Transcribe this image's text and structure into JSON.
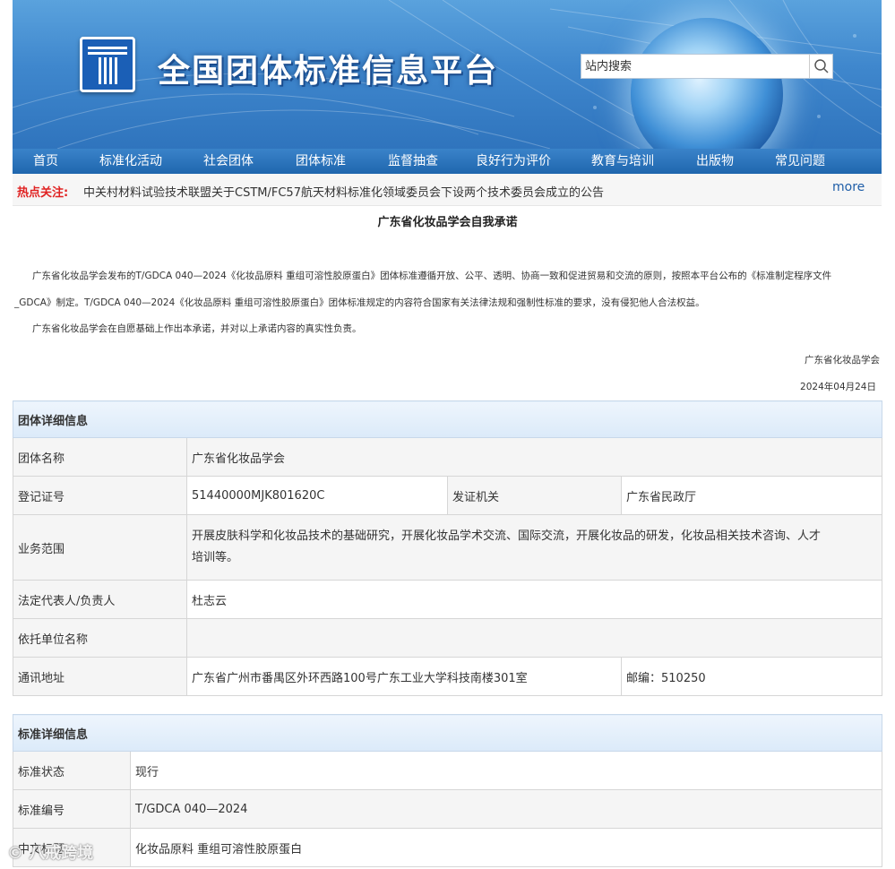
{
  "header": {
    "site_title": "全国团体标准信息平台",
    "search_placeholder": "站内搜索"
  },
  "nav": {
    "items": [
      "首页",
      "标准化活动",
      "社会团体",
      "团体标准",
      "监督抽查",
      "良好行为评价",
      "教育与培训",
      "出版物",
      "常见问题"
    ]
  },
  "hotbar": {
    "label": "热点关注:",
    "text": "中关村材料试验技术联盟关于CSTM/FC57航天材料标准化领域委员会下设两个技术委员会成立的公告",
    "more": "more"
  },
  "commitment": {
    "title": "广东省化妆品学会自我承诺",
    "para1_line1": "广东省化妆品学会发布的T/GDCA 040—2024《化妆品原料 重组可溶性胶原蛋白》团体标准遵循开放、公平、透明、协商一致和促进贸易和交流的原则，按照本平台公布的《标准制定程序文件",
    "para1_line2": "_GDCA》制定。T/GDCA 040—2024《化妆品原料 重组可溶性胶原蛋白》团体标准规定的内容符合国家有关法律法规和强制性标准的要求，没有侵犯他人合法权益。",
    "para2": "广东省化妆品学会在自愿基础上作出本承诺，并对以上承诺内容的真实性负责。",
    "signer": "广东省化妆品学会",
    "date": "2024年04月24日"
  },
  "group_info": {
    "heading": "团体详细信息",
    "name_label": "团体名称",
    "name_value": "广东省化妆品学会",
    "reg_label": "登记证号",
    "reg_value": "51440000MJK801620C",
    "issuer_label": "发证机关",
    "issuer_value": "广东省民政厅",
    "scope_label": "业务范围",
    "scope_line1": "开展皮肤科学和化妆品技术的基础研究，开展化妆品学术交流、国际交流，开展化妆品的研发，化妆品相关技术咨询、人才",
    "scope_line2": "培训等。",
    "rep_label": "法定代表人/负责人",
    "rep_value": "杜志云",
    "unit_label": "依托单位名称",
    "unit_value": "",
    "addr_label": "通讯地址",
    "addr_value": "广东省广州市番禺区外环西路100号广东工业大学科技南楼301室",
    "postcode": "邮编：510250"
  },
  "standard_info": {
    "heading": "标准详细信息",
    "status_label": "标准状态",
    "status_value": "现行",
    "code_label": "标准编号",
    "code_value": "T/GDCA 040—2024",
    "cn_title_label": "中文标题",
    "cn_title_value": "化妆品原料 重组可溶性胶原蛋白"
  },
  "watermark": "© 八戒跨境"
}
